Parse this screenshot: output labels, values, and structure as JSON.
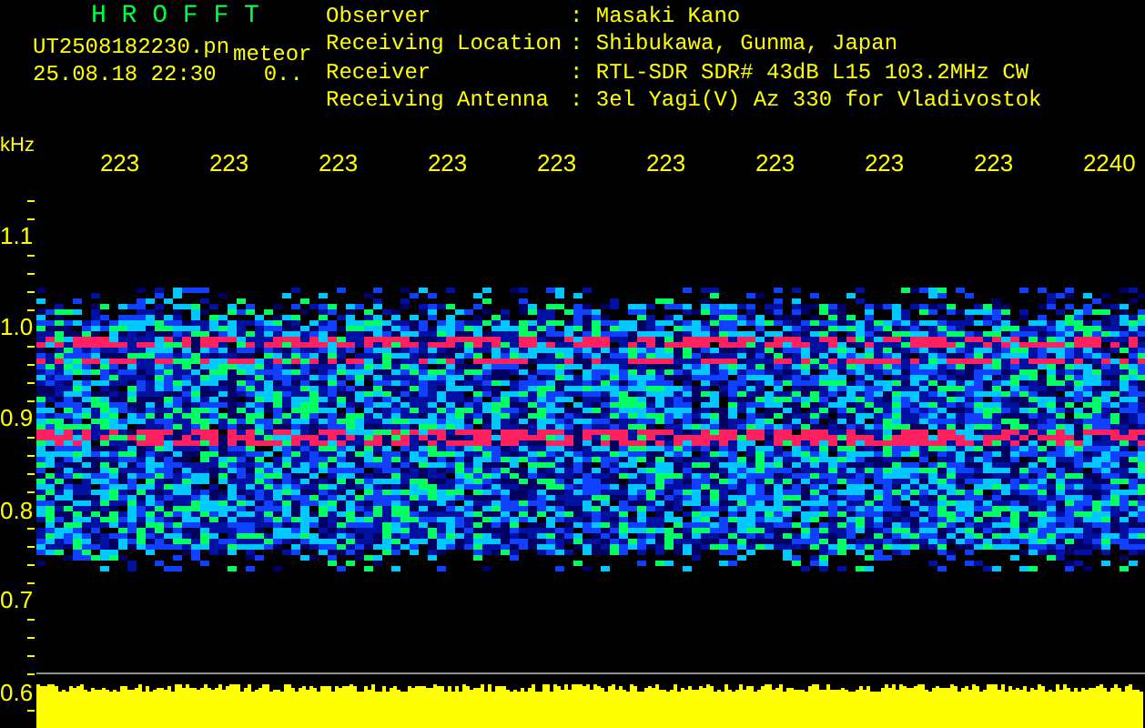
{
  "title": "H R O F F T",
  "file_name": "UT2508182230.pn",
  "event_type": "meteor",
  "timestamp": "25.08.18 22:30",
  "count": "0..",
  "info": [
    {
      "label": "Observer",
      "value": ": Masaki Kano"
    },
    {
      "label": "Receiving Location",
      "value": ": Shibukawa, Gunma, Japan"
    },
    {
      "label": "Receiver",
      "value": ": RTL-SDR SDR# 43dB L15 103.2MHz CW"
    },
    {
      "label": "Receiving Antenna",
      "value": ": 3el Yagi(V) Az 330 for Vladivostok"
    }
  ],
  "y_axis": {
    "unit": "kHz",
    "ticks": [
      "1.1",
      "1.0",
      "0.9",
      "0.8",
      "0.7",
      "0.6"
    ]
  },
  "x_axis": {
    "ticks": [
      "223",
      "223",
      "223",
      "223",
      "223",
      "223",
      "223",
      "223",
      "223",
      "2240"
    ]
  }
}
